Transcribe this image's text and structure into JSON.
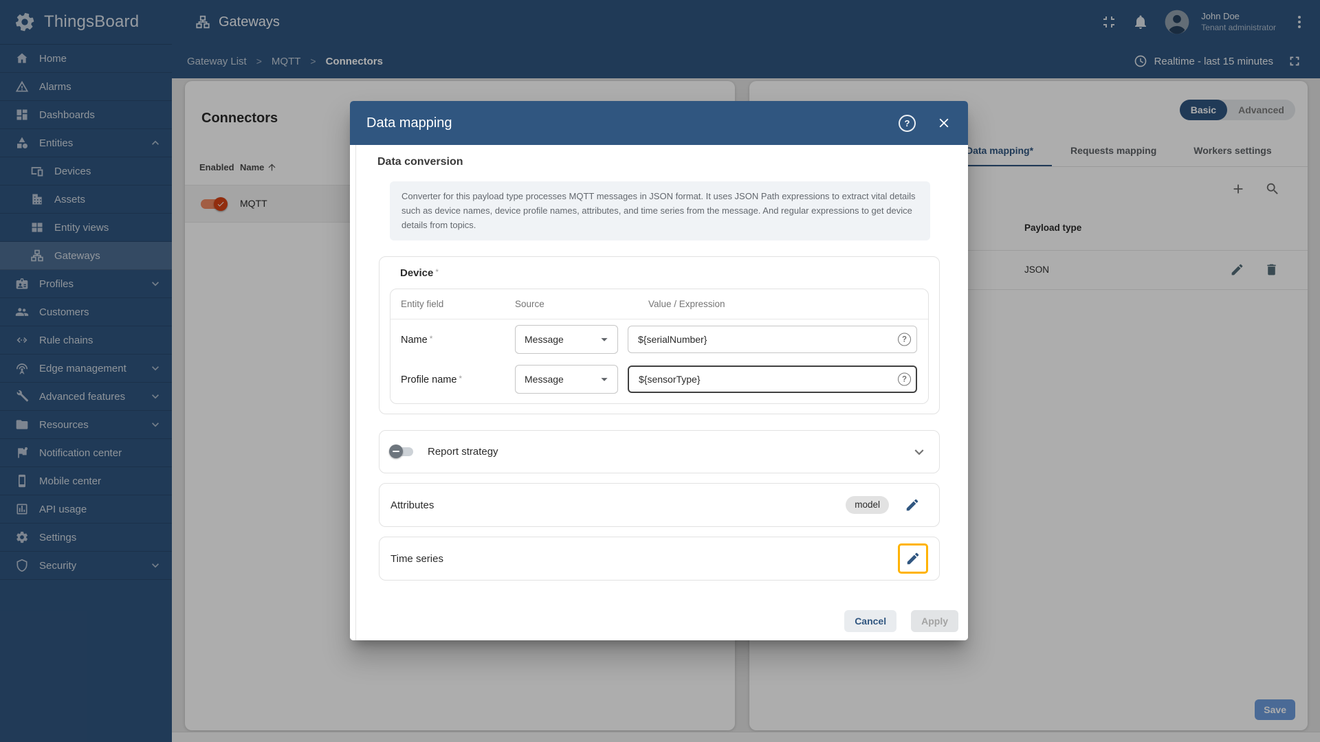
{
  "app": {
    "brand": "ThingsBoard",
    "page_title": "Gateways"
  },
  "header": {
    "user_name": "John Doe",
    "user_role": "Tenant administrator"
  },
  "breadcrumb": {
    "items": [
      "Gateway List",
      "MQTT",
      "Connectors"
    ],
    "separator": ">"
  },
  "toolbar": {
    "time_label": "Realtime - last 15 minutes"
  },
  "sidebar": {
    "items": [
      {
        "label": "Home",
        "icon": "home"
      },
      {
        "label": "Alarms",
        "icon": "alarms"
      },
      {
        "label": "Dashboards",
        "icon": "dashboards"
      },
      {
        "label": "Entities",
        "icon": "entities",
        "chevron": "up"
      },
      {
        "label": "Devices",
        "icon": "devices",
        "sub": true
      },
      {
        "label": "Assets",
        "icon": "assets",
        "sub": true
      },
      {
        "label": "Entity views",
        "icon": "entity-views",
        "sub": true
      },
      {
        "label": "Gateways",
        "icon": "gateways",
        "sub": true,
        "active": true
      },
      {
        "label": "Profiles",
        "icon": "profiles",
        "chevron": "down"
      },
      {
        "label": "Customers",
        "icon": "customers"
      },
      {
        "label": "Rule chains",
        "icon": "rule-chains"
      },
      {
        "label": "Edge management",
        "icon": "edge-management",
        "chevron": "down"
      },
      {
        "label": "Advanced features",
        "icon": "advanced-features",
        "chevron": "down"
      },
      {
        "label": "Resources",
        "icon": "resources",
        "chevron": "down"
      },
      {
        "label": "Notification center",
        "icon": "notification-center"
      },
      {
        "label": "Mobile center",
        "icon": "mobile-center"
      },
      {
        "label": "API usage",
        "icon": "api-usage"
      },
      {
        "label": "Settings",
        "icon": "settings"
      },
      {
        "label": "Security",
        "icon": "security",
        "chevron": "down"
      }
    ]
  },
  "connectors_panel": {
    "title": "Connectors",
    "columns": {
      "enabled": "Enabled",
      "name": "Name"
    },
    "rows": [
      {
        "name": "MQTT",
        "enabled": true
      }
    ]
  },
  "config_panel": {
    "mode_toggle": {
      "basic": "Basic",
      "advanced": "Advanced",
      "selected": "Basic"
    },
    "tabs": [
      {
        "label": "Data mapping*",
        "active": true
      },
      {
        "label": "Requests mapping",
        "active": false
      },
      {
        "label": "Workers settings",
        "active": false
      }
    ],
    "table": {
      "column": "Payload type",
      "rows": [
        {
          "payload_type": "JSON"
        }
      ]
    },
    "save_label": "Save"
  },
  "modal": {
    "title": "Data mapping",
    "section_title": "Data conversion",
    "info_text": "Converter for this payload type processes MQTT messages in JSON format. It uses JSON Path expressions to extract vital details such as device names, device profile names, attributes, and time series from the message. And regular expressions to get device details from topics.",
    "required_marker": "*",
    "help_glyph": "?",
    "device": {
      "title": "Device",
      "columns": {
        "field": "Entity field",
        "source": "Source",
        "value": "Value / Expression"
      },
      "rows": [
        {
          "field": "Name",
          "source": "Message",
          "value": "${serialNumber}"
        },
        {
          "field": "Profile name",
          "source": "Message",
          "value": "${sensorType}"
        }
      ]
    },
    "report_strategy": {
      "label": "Report strategy"
    },
    "attributes": {
      "label": "Attributes",
      "chip": "model"
    },
    "time_series": {
      "label": "Time series"
    },
    "footer": {
      "cancel": "Cancel",
      "apply": "Apply"
    }
  },
  "colors": {
    "primary": "#305680",
    "connector_toggle_on": "#d84315",
    "highlight_outline": "#ffb300",
    "save_button": "#6e9dde"
  }
}
